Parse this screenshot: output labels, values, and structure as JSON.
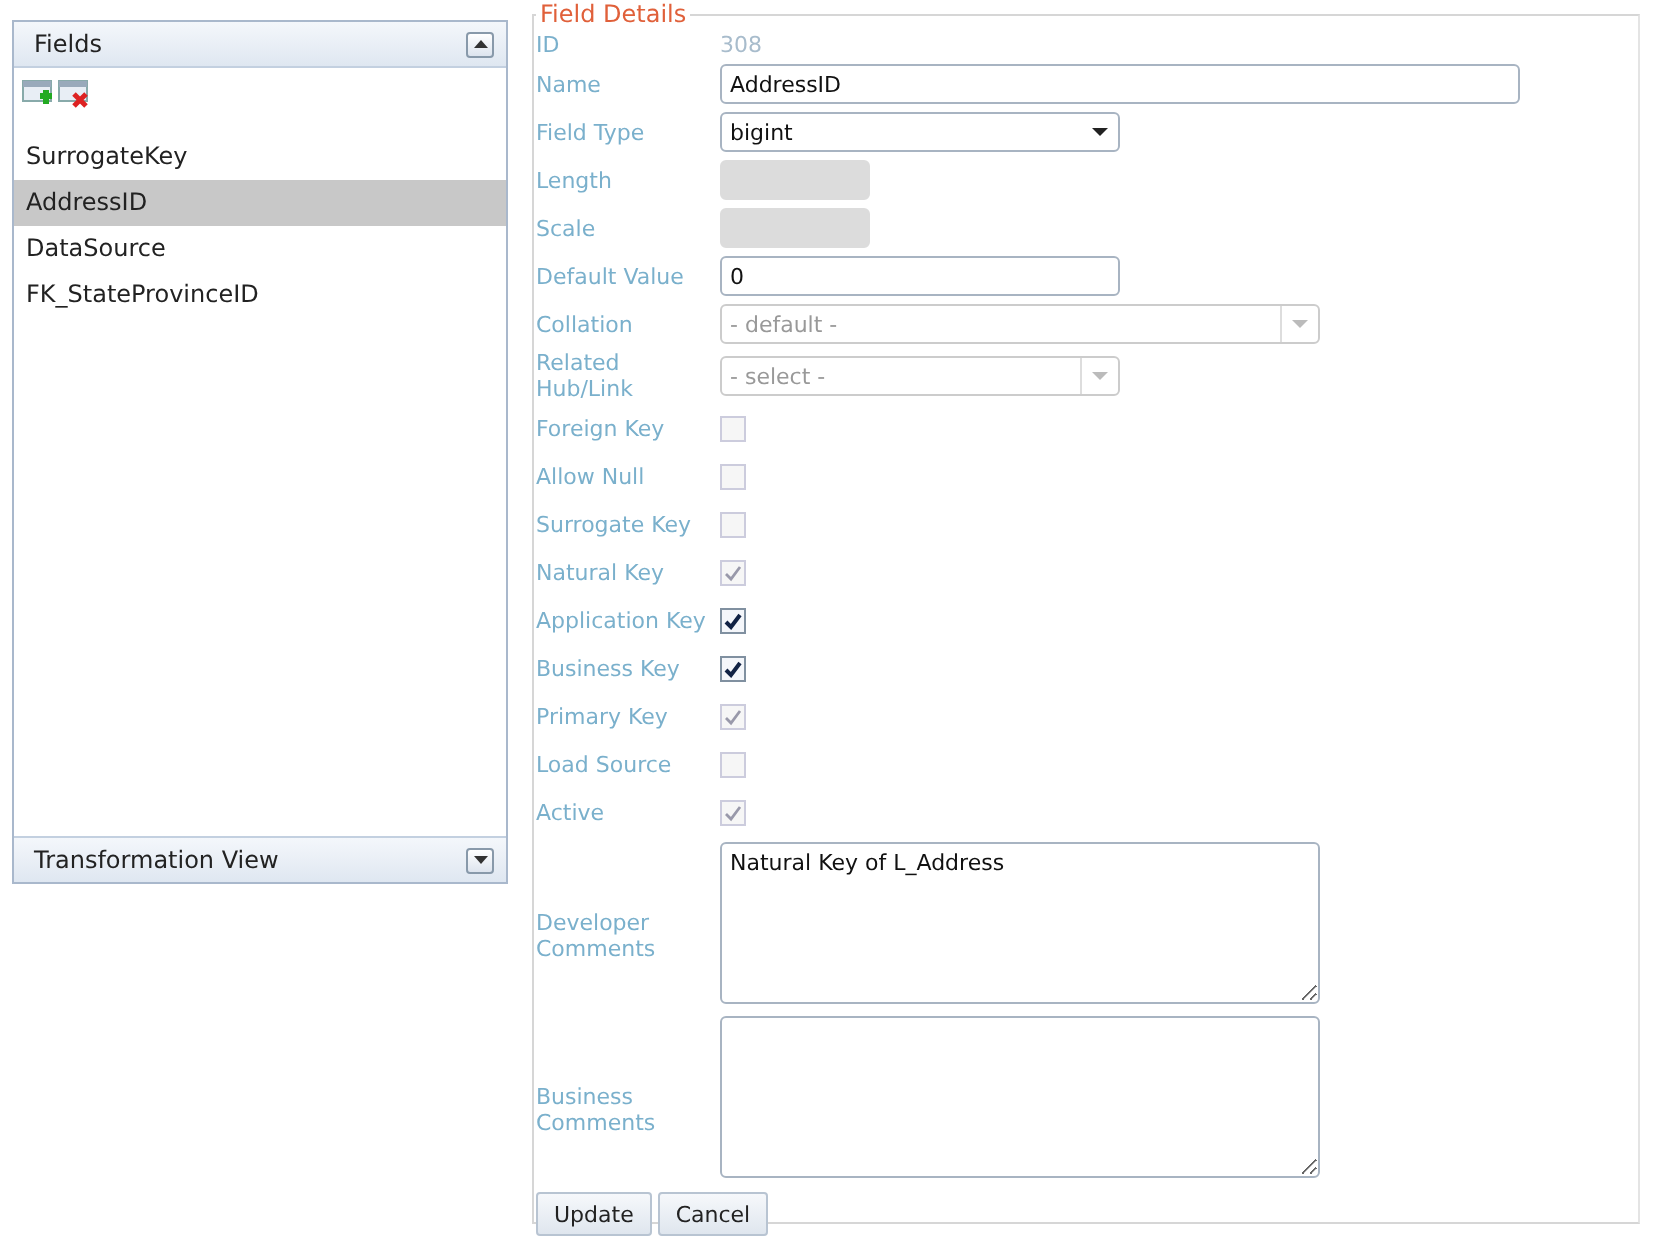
{
  "fields_panel": {
    "title": "Fields",
    "expanded": true,
    "items": [
      {
        "label": "SurrogateKey",
        "selected": false
      },
      {
        "label": "AddressID",
        "selected": true
      },
      {
        "label": "DataSource",
        "selected": false
      },
      {
        "label": "FK_StateProvinceID",
        "selected": false
      }
    ]
  },
  "transformation_panel": {
    "title": "Transformation View",
    "expanded": false
  },
  "field_details": {
    "legend": "Field Details",
    "rows": [
      {
        "kind": "static",
        "label": "ID",
        "value": "308"
      },
      {
        "kind": "text",
        "label": "Name",
        "value": "AddressID",
        "disabled": false
      },
      {
        "kind": "select",
        "label": "Field Type",
        "value": "bigint",
        "disabled": false
      },
      {
        "kind": "text",
        "label": "Length",
        "disabled": true
      },
      {
        "kind": "text",
        "label": "Scale",
        "disabled": true
      },
      {
        "kind": "text",
        "label": "Default Value",
        "value": "0",
        "disabled": false
      },
      {
        "kind": "select",
        "label": "Collation",
        "value": "- default -",
        "disabled": true
      },
      {
        "kind": "select",
        "label": "Related Hub/Link",
        "value": "- select -",
        "disabled": true
      },
      {
        "kind": "checkbox",
        "label": "Foreign Key",
        "checked": false,
        "disabled": true
      },
      {
        "kind": "checkbox",
        "label": "Allow Null",
        "checked": false,
        "disabled": true
      },
      {
        "kind": "checkbox",
        "label": "Surrogate Key",
        "checked": false,
        "disabled": true
      },
      {
        "kind": "checkbox",
        "label": "Natural Key",
        "checked": true,
        "disabled": true
      },
      {
        "kind": "checkbox",
        "label": "Application Key",
        "checked": true,
        "disabled": false
      },
      {
        "kind": "checkbox",
        "label": "Business Key",
        "checked": true,
        "disabled": false
      },
      {
        "kind": "checkbox",
        "label": "Primary Key",
        "checked": true,
        "disabled": true
      },
      {
        "kind": "checkbox",
        "label": "Load Source",
        "checked": false,
        "disabled": true
      },
      {
        "kind": "checkbox",
        "label": "Active",
        "checked": true,
        "disabled": true
      },
      {
        "kind": "textarea",
        "label": "Developer Comments",
        "value": "Natural Key of L_Address"
      },
      {
        "kind": "textarea",
        "label": "Business Comments"
      }
    ],
    "buttons": [
      "Update",
      "Cancel"
    ]
  }
}
